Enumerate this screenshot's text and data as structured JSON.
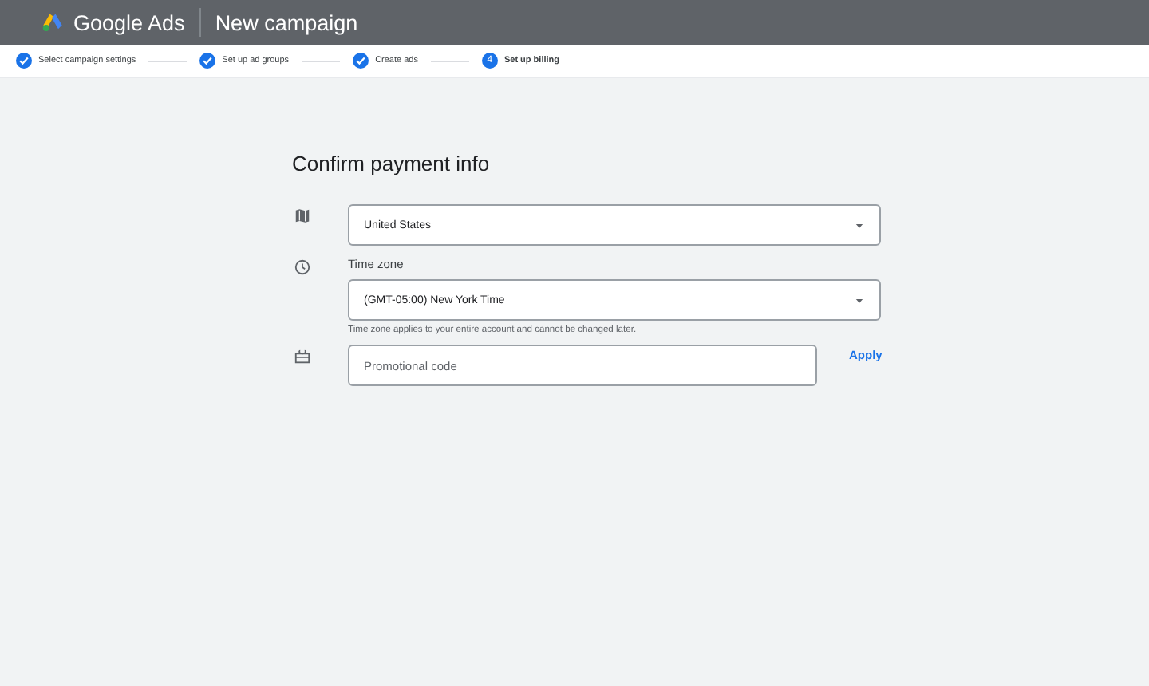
{
  "header": {
    "product": "Google Ads",
    "title": "New campaign"
  },
  "steps": [
    {
      "label": "Select campaign settings",
      "done": true
    },
    {
      "label": "Set up ad groups",
      "done": true
    },
    {
      "label": "Create ads",
      "done": true
    },
    {
      "label": "Set up billing",
      "done": false,
      "number": "4"
    }
  ],
  "form": {
    "title": "Confirm payment info",
    "rows": [
      {
        "kind": "select",
        "value": "United States"
      },
      {
        "kind": "select",
        "label": "Time zone",
        "value": "(GMT-05:00) New York Time",
        "hint": "Time zone applies to your entire account and cannot be changed later."
      },
      {
        "kind": "input",
        "placeholder": "Promotional code",
        "action": "Apply"
      }
    ]
  }
}
